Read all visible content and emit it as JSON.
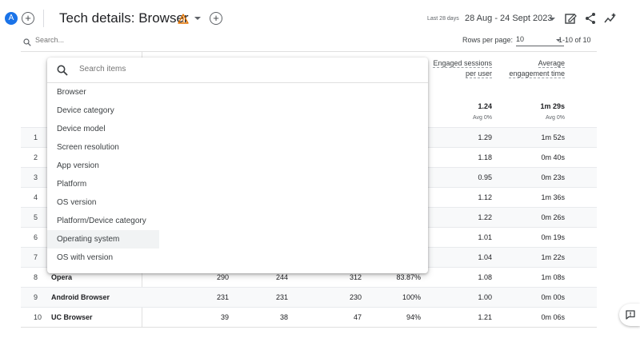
{
  "header": {
    "avatar_letter": "A",
    "add_left_label": "+",
    "title": "Tech details: Browser",
    "add_right_label": "+",
    "period_label": "Last 28 days",
    "date_range": "28 Aug - 24 Sept 2023",
    "icons": [
      "customize-report-icon",
      "share-icon",
      "insights-icon"
    ]
  },
  "search": {
    "placeholder": "Search...",
    "rows_per_page_label": "Rows per page:",
    "rows_per_page_value": "10",
    "range_text": "1-10 of 10"
  },
  "table": {
    "columns": [
      {
        "label": "Engaged sessions per user"
      },
      {
        "label": "Average engagement time"
      }
    ],
    "totals": {
      "engaged_per_user": "1.24",
      "engaged_per_user_avg": "Avg 0%",
      "avg_time": "1m 29s",
      "avg_time_avg": "Avg 0%"
    },
    "rows": [
      {
        "idx": "1",
        "name": "",
        "c1": "",
        "c2": "",
        "c3": "",
        "c4": "",
        "c5": "1.29",
        "c6": "1m 52s"
      },
      {
        "idx": "2",
        "name": "",
        "c1": "",
        "c2": "",
        "c3": "",
        "c4": "",
        "c5": "1.18",
        "c6": "0m 40s"
      },
      {
        "idx": "3",
        "name": "",
        "c1": "",
        "c2": "",
        "c3": "",
        "c4": "",
        "c5": "0.95",
        "c6": "0m 23s"
      },
      {
        "idx": "4",
        "name": "",
        "c1": "",
        "c2": "",
        "c3": "",
        "c4": "",
        "c5": "1.12",
        "c6": "1m 36s"
      },
      {
        "idx": "5",
        "name": "",
        "c1": "",
        "c2": "",
        "c3": "",
        "c4": "",
        "c5": "1.22",
        "c6": "0m 26s"
      },
      {
        "idx": "6",
        "name": "",
        "c1": "",
        "c2": "",
        "c3": "",
        "c4": "",
        "c5": "1.01",
        "c6": "0m 19s"
      },
      {
        "idx": "7",
        "name": "",
        "c1": "",
        "c2": "",
        "c3": "",
        "c4": "",
        "c5": "1.04",
        "c6": "1m 22s"
      },
      {
        "idx": "8",
        "name": "Opera",
        "c1": "290",
        "c2": "244",
        "c3": "312",
        "c4": "83.87%",
        "c5": "1.08",
        "c6": "1m 08s"
      },
      {
        "idx": "9",
        "name": "Android Browser",
        "c1": "231",
        "c2": "231",
        "c3": "230",
        "c4": "100%",
        "c5": "1.00",
        "c6": "0m 00s"
      },
      {
        "idx": "10",
        "name": "UC Browser",
        "c1": "39",
        "c2": "38",
        "c3": "47",
        "c4": "94%",
        "c5": "1.21",
        "c6": "0m 06s"
      }
    ]
  },
  "dropdown": {
    "search_placeholder": "Search items",
    "items": [
      "Browser",
      "Device category",
      "Device model",
      "Screen resolution",
      "App version",
      "Platform",
      "OS version",
      "Platform/Device category",
      "Operating system",
      "OS with version"
    ],
    "hovered_item": "Operating system"
  },
  "colors": {
    "accent": "#1a73e8",
    "warning": "#e37400",
    "text": "#202124",
    "muted": "#5f6368"
  }
}
